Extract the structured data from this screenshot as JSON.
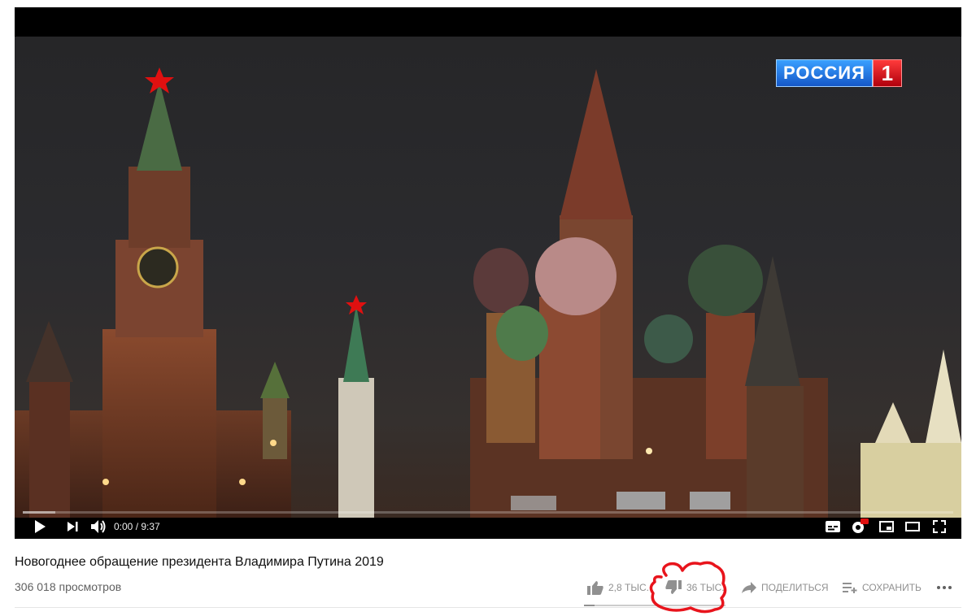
{
  "player": {
    "channel_logo": {
      "text": "РОССИЯ",
      "number": "1"
    },
    "time": "0:00 / 9:37",
    "progress_fraction": 0.0
  },
  "video": {
    "title": "Новогоднее обращение президента Владимира Путина 2019",
    "views": "306 018 просмотров"
  },
  "actions": {
    "like_count": "2,8 ТЫС.",
    "dislike_count": "36 ТЫС.",
    "share_label": "ПОДЕЛИТЬСЯ",
    "save_label": "СОХРАНИТЬ"
  },
  "icons": [
    "play-icon",
    "next-icon",
    "volume-icon",
    "subtitles-icon",
    "settings-hd-icon",
    "miniplayer-icon",
    "theater-icon",
    "fullscreen-icon",
    "thumbs-up-icon",
    "thumbs-down-icon",
    "share-icon",
    "save-playlist-icon",
    "more-icon"
  ],
  "colors": {
    "annotation": "#e8141c",
    "logo_blue": "#1457c8",
    "logo_red": "#d10b14"
  }
}
